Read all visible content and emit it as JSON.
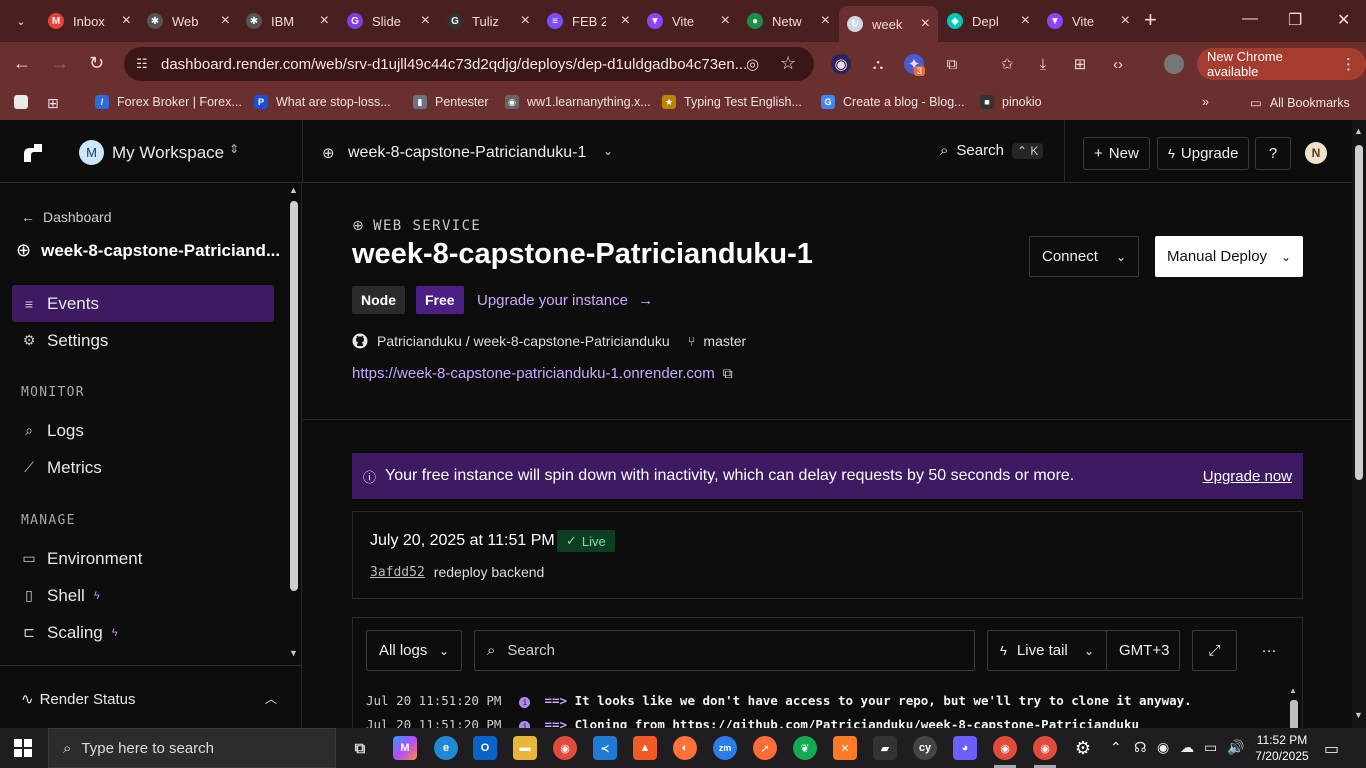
{
  "browser": {
    "tabs": [
      {
        "label": "Inbox",
        "color": "#ea4335",
        "glyph": "M"
      },
      {
        "label": "Web",
        "color": "#555555",
        "glyph": "✱"
      },
      {
        "label": "IBM",
        "color": "#555555",
        "glyph": "✱"
      },
      {
        "label": "Slide",
        "color": "#7b3fe4",
        "glyph": "G"
      },
      {
        "label": "Tuliz",
        "color": "#333333",
        "glyph": "G"
      },
      {
        "label": "FEB 2",
        "color": "#7c4dff",
        "glyph": "≡"
      },
      {
        "label": "Vite",
        "color": "#8e44ff",
        "glyph": "▼"
      },
      {
        "label": "Netw",
        "color": "#1b8f4a",
        "glyph": "●"
      },
      {
        "label": "week",
        "color": "#cfd6e6",
        "glyph": "↻"
      },
      {
        "label": "Depl",
        "color": "#00c7b7",
        "glyph": "◆"
      },
      {
        "label": "Vite",
        "color": "#8e44ff",
        "glyph": "▼"
      }
    ],
    "active_tab_index": 8,
    "url": "dashboard.render.com/web/srv-d1ujll49c44c73d2qdjg/deploys/dep-d1uldgadbo4c73en...",
    "extension_badge": "3",
    "new_chrome_label": "New Chrome available",
    "bookmarks": [
      {
        "label": "Forex Broker | Forex...",
        "color": "#2b6cd8",
        "glyph": "/"
      },
      {
        "label": "What are stop-loss...",
        "color": "#1d4ed8",
        "glyph": "P"
      },
      {
        "label": "Pentester",
        "color": "#6b7280",
        "glyph": "▮"
      },
      {
        "label": "ww1.learnanything.x...",
        "color": "#666666",
        "glyph": "◉"
      },
      {
        "label": "Typing Test English...",
        "color": "#b8860b",
        "glyph": "★"
      },
      {
        "label": "Create a blog - Blog...",
        "color": "#4285f4",
        "glyph": "G"
      },
      {
        "label": "pinokio",
        "color": "#333333",
        "glyph": "■"
      }
    ],
    "all_bookmarks_label": "All Bookmarks"
  },
  "app": {
    "workspace_initial": "M",
    "workspace_name": "My Workspace",
    "service_name_top": "week-8-capstone-Patricianduku-1",
    "search_label": "Search",
    "search_kbd": "⌃ K",
    "new_label": "New",
    "upgrade_label": "Upgrade",
    "user_initial": "N"
  },
  "sidebar": {
    "back_label": "Dashboard",
    "service_name": "week-8-capstone-Patriciand...",
    "items_top": [
      {
        "label": "Events",
        "icon": "≡"
      },
      {
        "label": "Settings",
        "icon": "⚙"
      }
    ],
    "monitor_heading": "MONITOR",
    "monitor_items": [
      {
        "label": "Logs",
        "icon": "⌕"
      },
      {
        "label": "Metrics",
        "icon": "⟋"
      }
    ],
    "manage_heading": "MANAGE",
    "manage_items": [
      {
        "label": "Environment",
        "icon": "▭"
      },
      {
        "label": "Shell",
        "icon": "▯"
      },
      {
        "label": "Scaling",
        "icon": "⊏"
      }
    ],
    "render_status_label": "Render Status"
  },
  "main": {
    "service_type": "WEB SERVICE",
    "title": "week-8-capstone-Patricianduku-1",
    "runtime_badge": "Node",
    "plan_badge": "Free",
    "upgrade_instance_label": "Upgrade your instance",
    "repo_label": "Patricianduku / week-8-capstone-Patricianduku",
    "branch_label": "master",
    "service_url": "https://week-8-capstone-patricianduku-1.onrender.com",
    "connect_label": "Connect",
    "manual_deploy_label": "Manual Deploy",
    "banner_text": "Your free instance will spin down with inactivity, which can delay requests by 50 seconds or more.",
    "banner_action": "Upgrade now",
    "deploy": {
      "date": "July 20, 2025 at 11:51 PM",
      "status": "Live",
      "commit_hash": "3afdd52",
      "commit_message": "redeploy backend"
    },
    "logs": {
      "filter_label": "All logs",
      "search_placeholder": "Search",
      "live_tail_label": "Live tail",
      "timezone_label": "GMT+3",
      "lines": [
        {
          "ts": "Jul 20 11:51:20 PM",
          "msg": "It looks like we don't have access to your repo, but we'll try to clone it anyway."
        },
        {
          "ts": "Jul 20 11:51:20 PM",
          "msg": "Cloning from https://github.com/Patricianduku/week-8-capstone-Patricianduku"
        }
      ]
    }
  },
  "taskbar": {
    "search_placeholder": "Type here to search",
    "time": "11:52 PM",
    "date": "7/20/2025"
  }
}
